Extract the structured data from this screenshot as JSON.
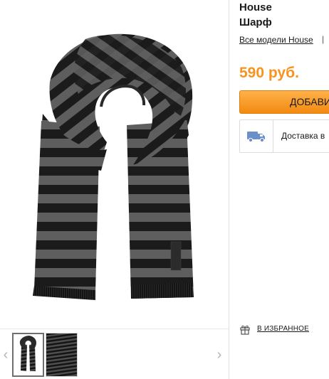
{
  "product": {
    "brand": "House",
    "name": "Шарф",
    "all_models_link": "Все модели House",
    "separator": "|",
    "price": "590 руб.",
    "add_button": "ДОБАВИ",
    "delivery": "Доставка в"
  },
  "gallery": {
    "arrow_left": "‹",
    "arrow_right": "›",
    "thumbnails": [
      "scarf-front",
      "scarf-stripes-closeup"
    ]
  },
  "favorites": {
    "label": "В ИЗБРАННОЕ"
  },
  "colors": {
    "price_orange": "#f7931e",
    "button_orange": "#f28a11",
    "truck_blue": "#6b8fc9"
  },
  "icons": {
    "truck": "truck-icon",
    "gift": "gift-icon"
  }
}
